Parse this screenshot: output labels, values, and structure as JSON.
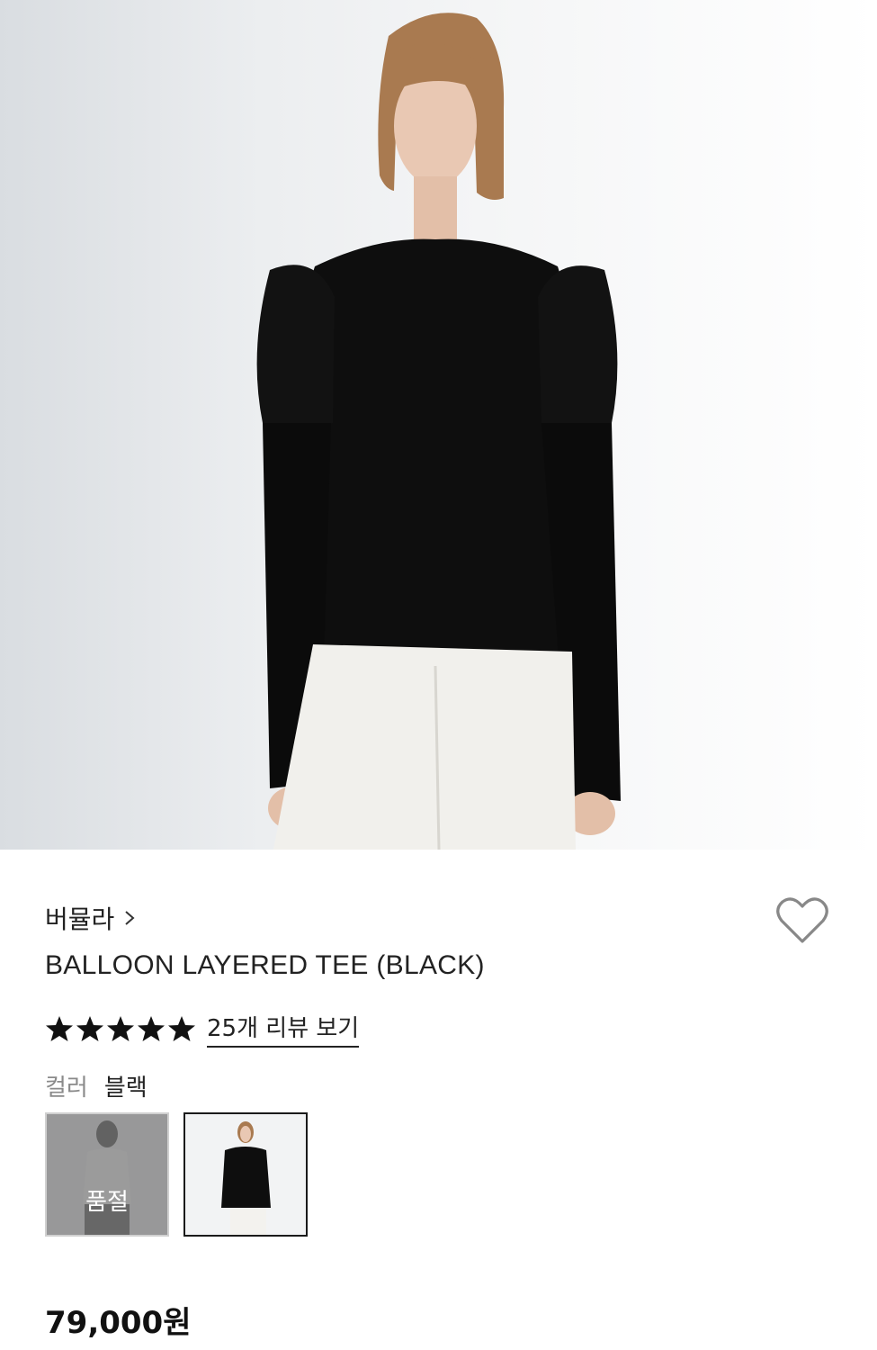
{
  "product": {
    "brand": "버뮬라",
    "title": "BALLOON LAYERED TEE (BLACK)",
    "rating": 5,
    "review_link": "25개 리뷰 보기",
    "color_label": "컬러",
    "color_value": "블랙",
    "swatches": [
      {
        "name": "white-variant",
        "status": "품절"
      },
      {
        "name": "black-variant",
        "selected": true
      }
    ],
    "price": "79,000원"
  },
  "icons": {
    "brand_chevron": "chevron-right-icon",
    "wishlist": "heart-outline-icon",
    "star": "star-filled-icon"
  },
  "colors": {
    "text": "#222222",
    "muted": "#8a8a8a",
    "selected_border": "#1a1a1a"
  }
}
